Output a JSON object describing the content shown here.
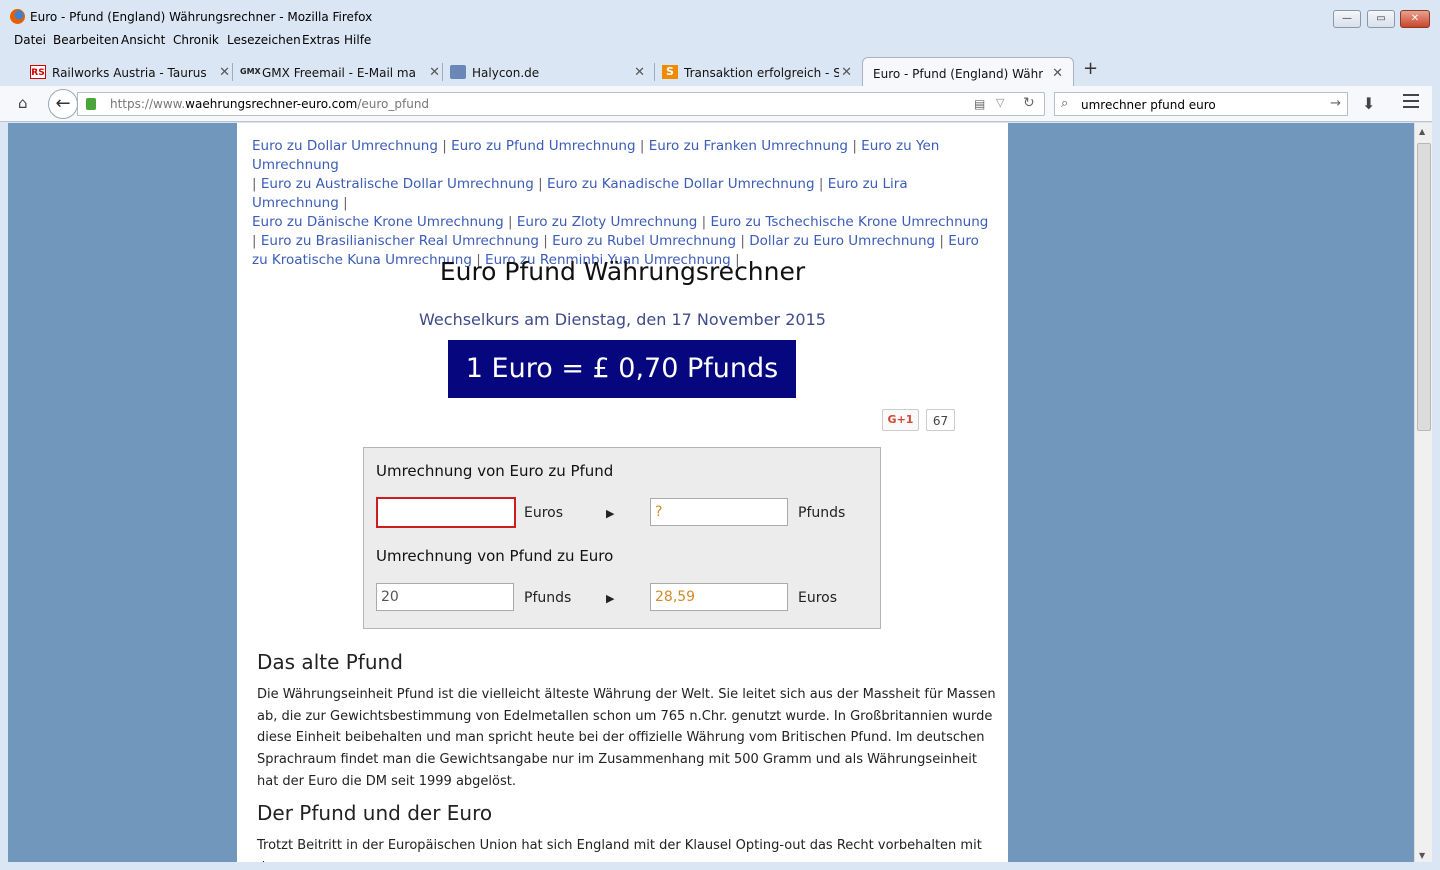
{
  "window": {
    "title": "Euro - Pfund (England) Währungsrechner - Mozilla Firefox"
  },
  "menu": [
    "Datei",
    "Bearbeiten",
    "Ansicht",
    "Chronik",
    "Lesezeichen",
    "Extras",
    "Hilfe"
  ],
  "tabs": [
    {
      "favicon": "RS",
      "label": "Railworks Austria - Taurus ..."
    },
    {
      "favicon": "GMX",
      "label": "GMX Freemail - E-Mail ma..."
    },
    {
      "favicon": "halycon-icon",
      "label": "Halycon.de"
    },
    {
      "favicon": "S",
      "label": "Transaktion erfolgreich - S..."
    },
    {
      "favicon": "",
      "label": "Euro - Pfund (England) Währu..."
    }
  ],
  "nav": {
    "url_prefix": "https://www.",
    "url_domain": "waehrungsrechner-euro.com",
    "url_path": "/euro_pfund",
    "search_value": "umrechner pfund euro"
  },
  "page": {
    "links": [
      "Euro zu Dollar Umrechnung",
      "Euro zu Pfund Umrechnung",
      "Euro zu Franken Umrechnung",
      "Euro zu Yen Umrechnung",
      "Euro zu Australische Dollar Umrechnung",
      "Euro zu Kanadische Dollar Umrechnung",
      "Euro zu Lira Umrechnung",
      "Euro zu Dänische Krone Umrechnung",
      "Euro zu Zloty Umrechnung",
      "Euro zu Tschechische Krone Umrechnung",
      "Euro zu Brasilianischer Real Umrechnung",
      "Euro zu Rubel Umrechnung",
      "Dollar zu Euro Umrechnung",
      "Euro zu Kroatische Kuna Umrechnung",
      "Euro zu Renminbi Yuan Umrechnung"
    ],
    "heading": "Euro Pfund Währungsrechner",
    "date_line": "Wechselkurs am Dienstag, den 17 November 2015",
    "rate": "1 Euro = £ 0,70 Pfunds",
    "gplus_label": "G+1",
    "gplus_count": "67",
    "calc": {
      "title1": "Umrechnung von Euro zu Pfund",
      "from1_value": "",
      "from1_unit": "Euros",
      "to1_value": "?",
      "to1_unit": "Pfunds",
      "title2": "Umrechnung von Pfund zu Euro",
      "from2_value": "20",
      "from2_unit": "Pfunds",
      "to2_value": "28,59",
      "to2_unit": "Euros",
      "arrow": "▶"
    },
    "section1_title": "Das alte Pfund",
    "section1_text": "Die Währungseinheit Pfund ist die vielleicht älteste Währung der Welt. Sie leitet sich aus der Massheit für Massen ab, die zur Gewichtsbestimmung von Edelmetallen schon um 765 n.Chr. genutzt wurde. In Großbritannien wurde diese Einheit beibehalten und man spricht heute bei der offizielle Währung vom Britischen Pfund. Im deutschen Sprachraum findet man die Gewichtsangabe nur im Zusammenhang mit 500 Gramm und als Währungseinheit hat der Euro die DM seit 1999 abgelöst.",
    "section2_title": "Der Pfund und der Euro",
    "section2_text": "Trotzt Beitritt in der Europäischen Union hat sich England mit der Klausel Opting-out das Recht vorbehalten mit dem"
  }
}
